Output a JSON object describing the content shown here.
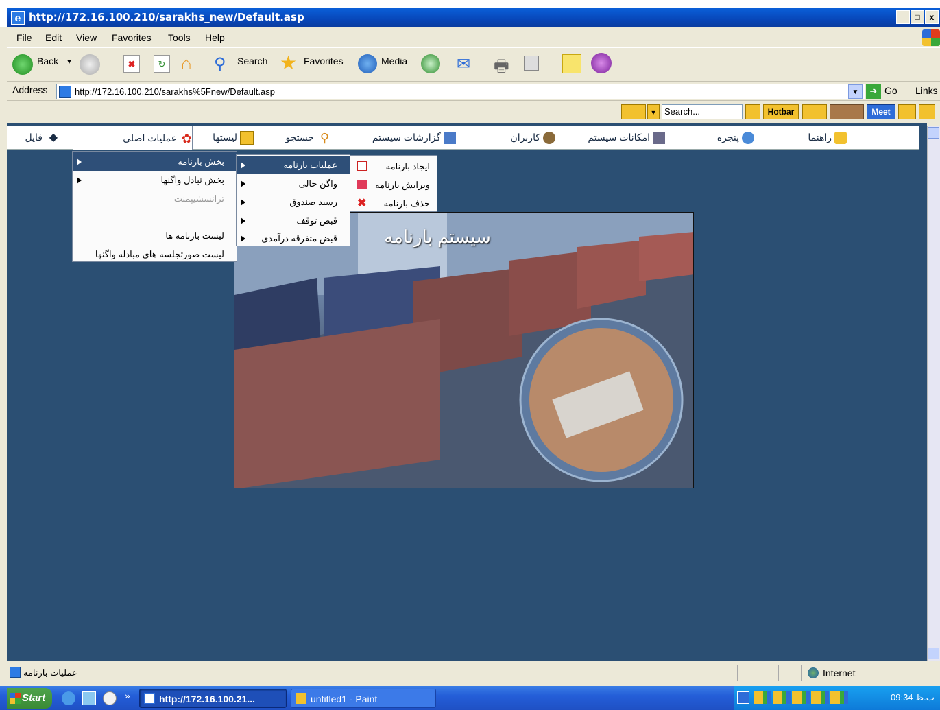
{
  "window": {
    "title": "http://172.16.100.210/sarakhs_new/Default.asp",
    "min": "_",
    "max": "□",
    "close": "x"
  },
  "menubar": [
    "File",
    "Edit",
    "View",
    "Favorites",
    "Tools",
    "Help"
  ],
  "toolbar": {
    "back": "Back",
    "search": "Search",
    "favorites": "Favorites",
    "media": "Media"
  },
  "address": {
    "label": "Address",
    "url": "http://172.16.100.210/sarakhs%5Fnew/Default.asp",
    "go": "Go",
    "links": "Links"
  },
  "links_toolbar": {
    "search_placeholder": "Search...",
    "hotbar": "Hotbar",
    "meet": "Meet"
  },
  "nav": {
    "file": "فایل",
    "main_ops": "عملیات اصلی",
    "lists": "لیستها",
    "search": "جستجو",
    "reports": "گزارشات سیستم",
    "users": "کاربران",
    "facilities": "امکانات سیستم",
    "windows": "پنجره",
    "help": "راهنما"
  },
  "menu1": {
    "items": [
      "بخش بارنامه",
      "بخش تبادل واگنها",
      "ترانسشیپمنت",
      "لیست بارنامه ها",
      "لیست صورتجلسه های مبادله واگنها"
    ]
  },
  "menu2": {
    "items": [
      "عملیات بارنامه",
      "واگن خالی",
      "رسید صندوق",
      "قبض توقف",
      "قبض متفرقه درآمدی"
    ]
  },
  "menu3": {
    "items": [
      "ایجاد بارنامه",
      "ویرایش بارنامه",
      "حذف بارنامه"
    ]
  },
  "hero": {
    "title": "سیستم بارنامه"
  },
  "statusbar": {
    "text": "عملیات بارنامه",
    "zone": "Internet"
  },
  "taskbar": {
    "start": "Start",
    "task1": "http://172.16.100.21...",
    "task2": "untitled1 - Paint",
    "clock": "09:34 ب.ظ"
  },
  "colors": {
    "page_bg": "#2b4f73",
    "menu_highlight": "#2e4f78",
    "title_bar": "#0a52c8"
  }
}
